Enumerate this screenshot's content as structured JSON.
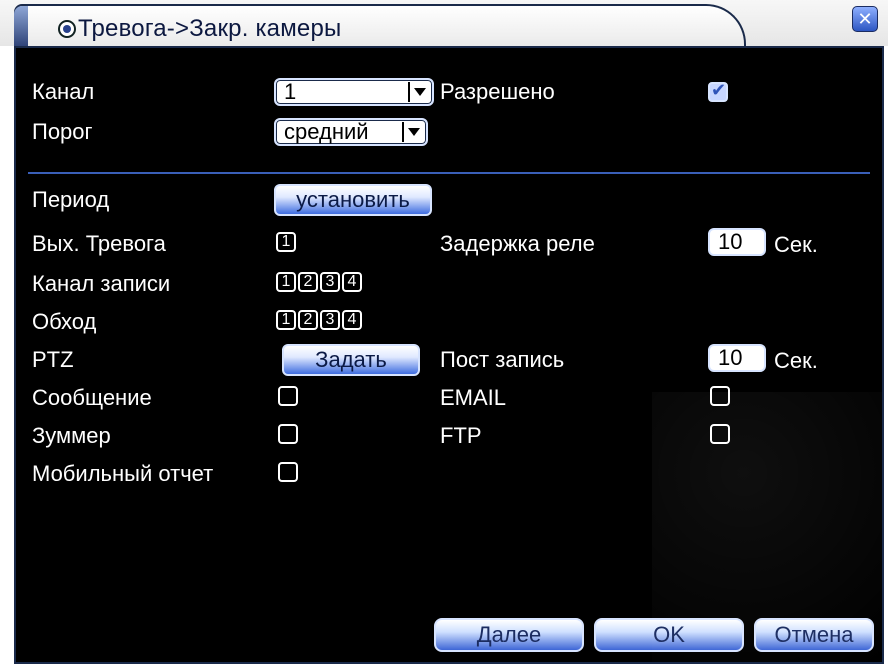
{
  "window": {
    "title": "Тревога->Закр. камеры",
    "close_label": "✕"
  },
  "form": {
    "channel": {
      "label": "Канал",
      "value": "1"
    },
    "enabled": {
      "label": "Разрешено",
      "checked": true
    },
    "threshold": {
      "label": "Порог",
      "value": "средний"
    },
    "period": {
      "label": "Период",
      "button_label": "установить"
    },
    "alarm_out": {
      "label": "Вых. Тревога",
      "channels": [
        "1"
      ]
    },
    "relay_delay": {
      "label": "Задержка реле",
      "value": "10",
      "unit": "Сек."
    },
    "record_channel": {
      "label": "Канал записи",
      "channels": [
        "1",
        "2",
        "3",
        "4"
      ]
    },
    "tour": {
      "label": "Обход",
      "channels": [
        "1",
        "2",
        "3",
        "4"
      ]
    },
    "ptz": {
      "label": "PTZ",
      "button_label": "Задать"
    },
    "post_record": {
      "label": "Пост запись",
      "value": "10",
      "unit": "Сек."
    },
    "message": {
      "label": "Сообщение",
      "checked": false
    },
    "email": {
      "label": "EMAIL",
      "checked": false
    },
    "buzzer": {
      "label": "Зуммер",
      "checked": false
    },
    "ftp": {
      "label": "FTP",
      "checked": false
    },
    "mobile_report": {
      "label": "Мобильный отчет",
      "checked": false
    }
  },
  "footer": {
    "next_label": "Далее",
    "ok_label": "OK",
    "cancel_label": "Отмена"
  }
}
